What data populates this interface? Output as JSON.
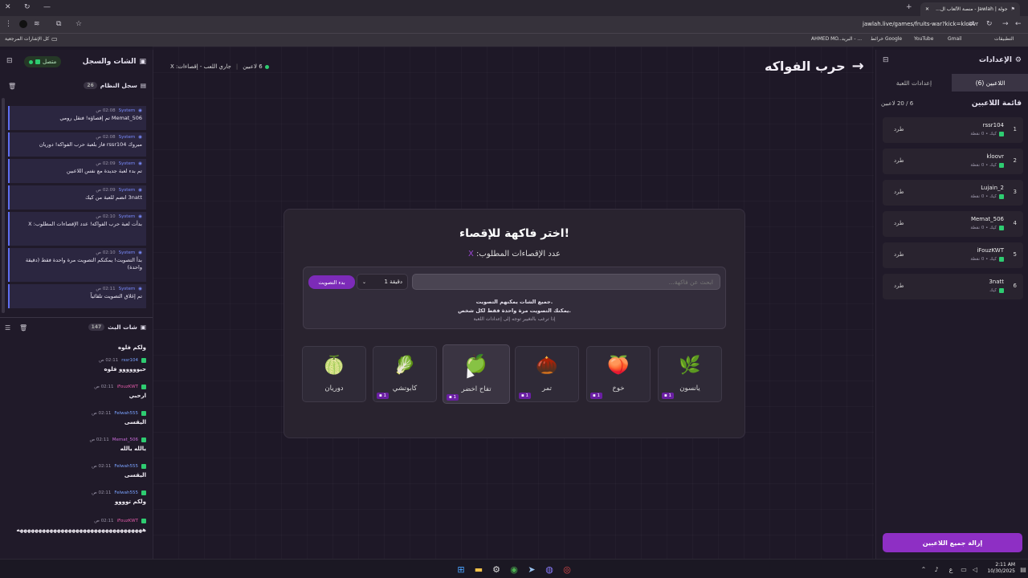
{
  "browser": {
    "active_tab_title": "جولة | Jawlah - منصة الألعاب ال...",
    "url": "jawlah.live/games/fruits-war?kick=kloovr",
    "bookmarks": [
      "التطبيقات",
      "Gmail",
      "YouTube",
      "خرائط Google",
      "البريد - ...",
      "AHMED MO..."
    ],
    "all_bookmarks": "كل الإشارات المرجعية"
  },
  "left_panel": {
    "title": "الشات والسجل",
    "status": "متصل",
    "system_log": {
      "title": "سجل النظام",
      "count": "26",
      "messages": [
        {
          "sender": "System",
          "time": "02:08 ص",
          "text": "Memat_506 تم إقصاؤه! فتقل رومي"
        },
        {
          "sender": "System",
          "time": "02:08 ص",
          "text": "مبروك rssr104 فاز بلعبة حرب الفواكه! دوريان"
        },
        {
          "sender": "System",
          "time": "02:09 ص",
          "text": "تم بدء لعبة جديدة مع نفس اللاعبين"
        },
        {
          "sender": "System",
          "time": "02:09 ص",
          "text": "3natt انضم للعبة من كيك"
        },
        {
          "sender": "System",
          "time": "02:10 ص",
          "text": "بدأت لعبة حرب الفواكه! عدد الإقصاءات المطلوب: X"
        },
        {
          "sender": "System",
          "time": "02:10 ص",
          "text": "بدأ التصويت! يمكنكم التصويت مرة واحدة فقط (دقيقة واحدة)"
        },
        {
          "sender": "System",
          "time": "02:11 ص",
          "text": "تم إغلاق التصويت تلقائياً"
        }
      ]
    },
    "live_chat": {
      "title": "شات البث",
      "count": "147",
      "first_text": "ولكم فلوه",
      "messages": [
        {
          "user": "rssr104",
          "time": "02:11 ص",
          "text": "حيوووووو فلوه",
          "color": "#7aa2ff"
        },
        {
          "user": "iFouzKWT",
          "time": "02:11 ص",
          "text": "ارحبي",
          "color": "#e05aa8"
        },
        {
          "user": "Felwah555",
          "time": "02:11 ص",
          "text": "اليقسى",
          "color": "#7aa2ff"
        },
        {
          "user": "Memat_506",
          "time": "02:11 ص",
          "text": "يالله يالله",
          "color": "#c86bd8"
        },
        {
          "user": "Felwah555",
          "time": "02:11 ص",
          "text": "اليقسى",
          "color": "#7aa2ff"
        },
        {
          "user": "Felwah555",
          "time": "02:11 ص",
          "text": "ولكم توووو",
          "color": "#7aa2ff"
        },
        {
          "user": "iFouzKWT",
          "time": "02:11 ص",
          "text": "ههههههههههههههههههههههههههههههههههه",
          "color": "#e05aa8"
        }
      ]
    }
  },
  "header": {
    "game_title": "حرب الفواكه",
    "status": "جاري اللعب - إقصاءات: X",
    "players": "6 لاعبين"
  },
  "card": {
    "title": "اختر فاكهة للإقصاء!",
    "subtitle": "عدد الإقصاءات المطلوب:",
    "subtitle_value": "X",
    "search_placeholder": "ابحث عن فاكهة...",
    "duration": "1 دقيقة",
    "start_button": "بدء التصويت",
    "info_line1": "جميع الشات يمكنهم التصويت.",
    "info_line2": "يمكنك التصويت مرة واحدة فقط لكل شخص.",
    "info_line3": "إذا ترغب بالتغيير توجه إلى إعدادات اللعبة",
    "fruits": [
      {
        "name": "يانسون",
        "emoji": "🌿",
        "votes": "1"
      },
      {
        "name": "خوخ",
        "emoji": "🍑",
        "votes": "1"
      },
      {
        "name": "تمر",
        "emoji": "🌰",
        "votes": "1"
      },
      {
        "name": "تفاح اخضر",
        "emoji": "🍏",
        "votes": "1"
      },
      {
        "name": "كابوتشي",
        "emoji": "🥬",
        "votes": "1"
      },
      {
        "name": "دوريان",
        "emoji": "🍈",
        "votes": ""
      }
    ]
  },
  "right_panel": {
    "title": "الإعدادات",
    "tab_players": "اللاعبين (6)",
    "tab_settings": "إعدادات اللعبة",
    "list_title": "قائمة اللاعبين",
    "list_count": "6 / 20 لاعبين",
    "kick_label": "طرد",
    "players": [
      {
        "num": "1",
        "name": "rssr104",
        "sub": "كيك • 0 نقطة"
      },
      {
        "num": "2",
        "name": "kloovr",
        "sub": "كيك • 0 نقطة"
      },
      {
        "num": "3",
        "name": "Lujain_2",
        "sub": "كيك • 0 نقطة"
      },
      {
        "num": "4",
        "name": "Memat_506",
        "sub": "كيك • 0 نقطة"
      },
      {
        "num": "5",
        "name": "iFouzKWT",
        "sub": "كيك • 0 نقطة"
      },
      {
        "num": "6",
        "name": "3natt",
        "sub": "كيك"
      }
    ],
    "remove_all": "إزالة جميع اللاعبين"
  },
  "taskbar": {
    "time": "2:11 AM",
    "date": "10/30/2025",
    "lang": "ع"
  }
}
